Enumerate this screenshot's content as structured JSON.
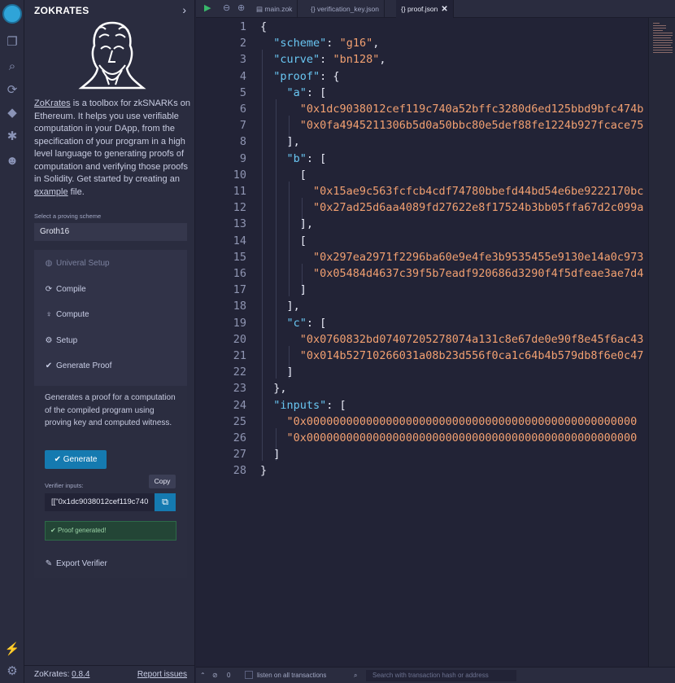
{
  "app": {
    "title": "ZOKRATES"
  },
  "sidebar": {
    "description_link": "ZoKrates",
    "description": " is a toolbox for zkSNARKs on Ethereum. It helps you use verifiable computation in your DApp, from the specification of your program in a high level language to generating proofs of computation and verifying those proofs in Solidity. Get started by creating an ",
    "example_link": "example",
    "description_tail": " file.",
    "scheme_label": "Select a proving scheme",
    "scheme_value": "Groth16",
    "steps": [
      {
        "label": "Univeral Setup",
        "icon": "globe-icon"
      },
      {
        "label": "Compile",
        "icon": "refresh-icon"
      },
      {
        "label": "Compute",
        "icon": "lightbulb-icon"
      },
      {
        "label": "Setup",
        "icon": "gear-icon"
      },
      {
        "label": "Generate Proof",
        "icon": "check-icon"
      }
    ],
    "generate_text": "Generates a proof for a computation of the compiled program using proving key and computed witness.",
    "generate_button": "Generate",
    "verifier_label": "Verifier inputs:",
    "verifier_value": "[[\"0x1dc9038012cef119c740",
    "copy_tooltip": "Copy",
    "status_message": "Proof generated!",
    "export_label": "Export Verifier",
    "footer_label": "ZoKrates: ",
    "footer_version": "0.8.4",
    "footer_report": "Report issues"
  },
  "tabs": [
    {
      "label": "main.zok",
      "icon": "file-icon"
    },
    {
      "label": "verification_key.json",
      "icon": "braces-icon"
    },
    {
      "label": "proof.json",
      "icon": "braces-icon",
      "active": true
    }
  ],
  "editor": {
    "lines": [
      "{",
      "  \"scheme\": \"g16\",",
      "  \"curve\": \"bn128\",",
      "  \"proof\": {",
      "    \"a\": [",
      "      \"0x1dc9038012cef119c740a52bffc3280d6ed125bbd9bfc474b",
      "      \"0x0fa4945211306b5d0a50bbc80e5def88fe1224b927fcace75",
      "    ],",
      "    \"b\": [",
      "      [",
      "        \"0x15ae9c563fcfcb4cdf74780bbefd44bd54e6be9222170bc",
      "        \"0x27ad25d6aa4089fd27622e8f17524b3bb05ffa67d2c099a",
      "      ],",
      "      [",
      "        \"0x297ea2971f2296ba60e9e4fe3b9535455e9130e14a0c973",
      "        \"0x05484d4637c39f5b7eadf920686d3290f4f5dfeae3ae7d4",
      "      ]",
      "    ],",
      "    \"c\": [",
      "      \"0x0760832bd07407205278074a131c8e67de0e90f8e45f6ac43",
      "      \"0x014b52710266031a08b23d556f0ca1c64b4b579db8f6e0c47",
      "    ]",
      "  },",
      "  \"inputs\": [",
      "    \"0x00000000000000000000000000000000000000000000000000",
      "    \"0x00000000000000000000000000000000000000000000000000",
      "  ]",
      "}"
    ]
  },
  "statusbar": {
    "count": "0",
    "listen_label": "listen on all transactions",
    "search_placeholder": "Search with transaction hash or address"
  }
}
